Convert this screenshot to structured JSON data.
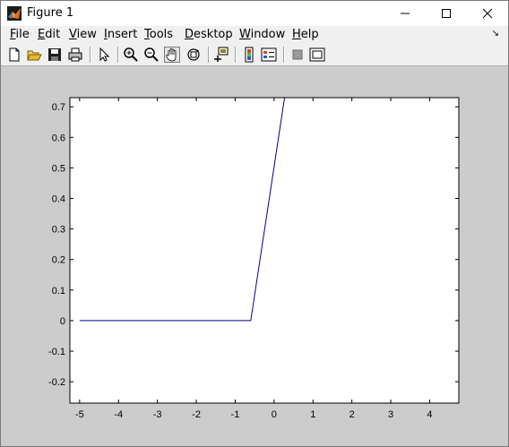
{
  "window": {
    "title": "Figure 1"
  },
  "menu": [
    {
      "pre": "",
      "ul": "F",
      "post": "ile"
    },
    {
      "pre": "",
      "ul": "E",
      "post": "dit"
    },
    {
      "pre": "",
      "ul": "V",
      "post": "iew"
    },
    {
      "pre": "",
      "ul": "I",
      "post": "nsert"
    },
    {
      "pre": "",
      "ul": "T",
      "post": "ools"
    },
    {
      "pre": "",
      "ul": "D",
      "post": "esktop"
    },
    {
      "pre": "",
      "ul": "W",
      "post": "indow"
    },
    {
      "pre": "",
      "ul": "H",
      "post": "elp"
    }
  ],
  "toolbar": {
    "buttons": [
      "new-figure-icon",
      "open-file-icon",
      "save-icon",
      "print-icon",
      "edit-plot-arrow-icon",
      "zoom-in-icon",
      "zoom-out-icon",
      "pan-hand-icon",
      "rotate-3d-icon",
      "data-cursor-icon",
      "insert-colorbar-icon",
      "insert-legend-icon",
      "hide-plot-tools-icon",
      "show-plot-tools-icon"
    ],
    "active": "pan-hand-icon"
  },
  "chart_data": {
    "type": "line",
    "x": [
      -5,
      -0.6,
      0.27
    ],
    "series": [
      {
        "values": [
          0,
          0,
          0.73
        ],
        "color": "#00008b"
      }
    ],
    "xlim": [
      -5.25,
      4.75
    ],
    "ylim": [
      -0.27,
      0.73
    ],
    "xticks": [
      "-5",
      "-4",
      "-3",
      "-2",
      "-1",
      "0",
      "1",
      "2",
      "3",
      "4"
    ],
    "yticks": [
      "0.7",
      "0.6",
      "0.5",
      "0.4",
      "0.3",
      "0.2",
      "0.1",
      "0",
      "-0.1",
      "-0.2"
    ],
    "title": "",
    "xlabel": "",
    "ylabel": "",
    "grid": false
  }
}
